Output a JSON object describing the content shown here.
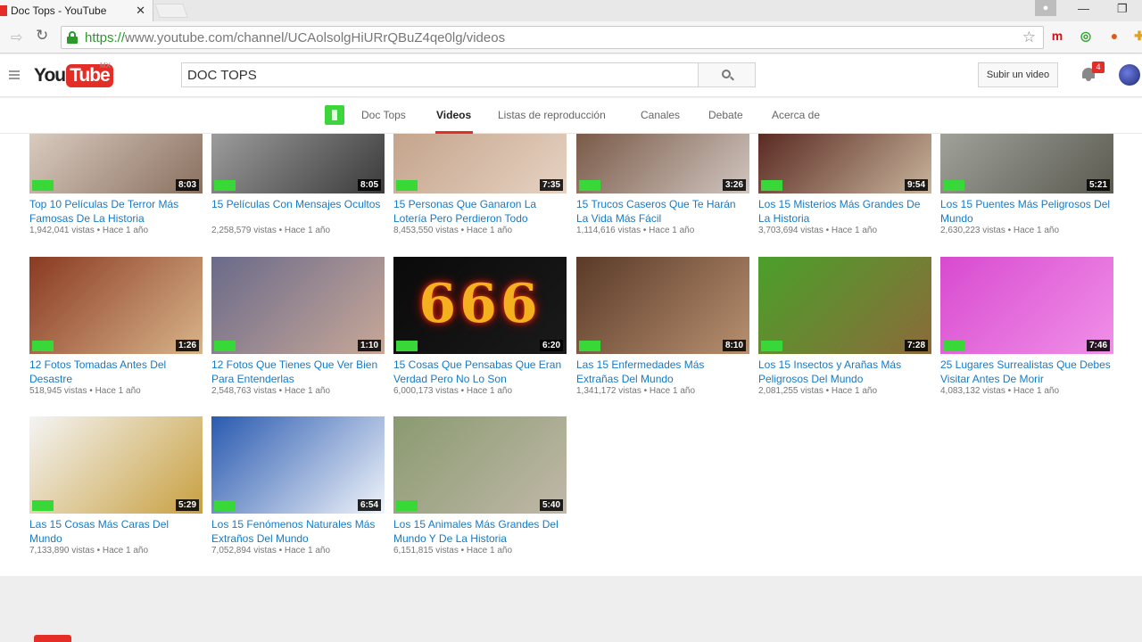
{
  "browser": {
    "tab_title": "Doc Tops - YouTube",
    "tab_close": "✕",
    "url_scheme": "https://",
    "url_rest": "www.youtube.com/channel/UCAolsolgHiURrQBuZ4qe0lg/videos",
    "back_icon": "⇨",
    "reload_icon": "↻",
    "star_icon": "☆",
    "minimize": "—",
    "restore": "❐",
    "extensions": [
      {
        "label": "m",
        "color": "#d0101c"
      },
      {
        "label": "◎",
        "color": "#2ea32e"
      },
      {
        "label": "●",
        "color": "#e05a18"
      }
    ]
  },
  "masthead": {
    "logo_you": "You",
    "logo_tube": "Tube",
    "logo_region": "MX",
    "search_value": "DOC TOPS",
    "upload_label": "Subir un video",
    "notification_count": "4"
  },
  "channel_tabs": {
    "items": [
      "Doc Tops",
      "Videos",
      "Listas de reproducción",
      "Canales",
      "Debate",
      "Acerca de"
    ],
    "active": "Videos"
  },
  "videos": [
    {
      "title": "Top 10 Películas De Terror Más Famosas De La Historia",
      "views": "1,942,041 vistas",
      "age": "Hace 1 año",
      "duration": "8:03",
      "thumb_colors": [
        "#d9cbbf",
        "#8a7060"
      ]
    },
    {
      "title": "15 Películas Con Mensajes Ocultos",
      "views": "2,258,579 vistas",
      "age": "Hace 1 año",
      "duration": "8:05",
      "thumb_colors": [
        "#9c9c9c",
        "#3a3a3a"
      ]
    },
    {
      "title": "15 Personas Que Ganaron La Lotería Pero Perdieron Todo",
      "views": "8,453,550 vistas",
      "age": "Hace 1 año",
      "duration": "7:35",
      "thumb_colors": [
        "#c4a48c",
        "#e6d2c2"
      ]
    },
    {
      "title": "15 Trucos Caseros Que Te Harán La Vida Más Fácil",
      "views": "1,114,616 vistas",
      "age": "Hace 1 año",
      "duration": "3:26",
      "thumb_colors": [
        "#7a5a48",
        "#d0c6c0"
      ]
    },
    {
      "title": "Los 15 Misterios Más Grandes De La Historia",
      "views": "3,703,694 vistas",
      "age": "Hace 1 año",
      "duration": "9:54",
      "thumb_colors": [
        "#5a2a22",
        "#c8b49c"
      ]
    },
    {
      "title": "Los 15 Puentes Más Peligrosos Del Mundo",
      "views": "2,630,223 vistas",
      "age": "Hace 1 año",
      "duration": "5:21",
      "thumb_colors": [
        "#a0a29a",
        "#5a5a50"
      ]
    },
    {
      "title": "12 Fotos Tomadas Antes Del Desastre",
      "views": "518,945 vistas",
      "age": "Hace 1 año",
      "duration": "1:26",
      "thumb_colors": [
        "#8a3a22",
        "#d8b48a"
      ]
    },
    {
      "title": "12 Fotos Que Tienes Que Ver Bien Para Entenderlas",
      "views": "2,548,763 vistas",
      "age": "Hace 1 año",
      "duration": "1:10",
      "thumb_colors": [
        "#6a6a8a",
        "#c8a898"
      ]
    },
    {
      "title": "15 Cosas Que Pensabas Que Eran Verdad Pero No Lo Son",
      "views": "6,000,173 vistas",
      "age": "Hace 1 año",
      "duration": "6:20",
      "thumb_colors": [
        "#0a0a0a",
        "#1a1a1a"
      ],
      "thumb_text": "666"
    },
    {
      "title": "Las 15 Enfermedades Más Extrañas Del Mundo",
      "views": "1,341,172 vistas",
      "age": "Hace 1 año",
      "duration": "8:10",
      "thumb_colors": [
        "#5a3a28",
        "#b89070"
      ]
    },
    {
      "title": "Los 15 Insectos y Arañas Más Peligrosos Del Mundo",
      "views": "2,081,255 vistas",
      "age": "Hace 1 año",
      "duration": "7:28",
      "thumb_colors": [
        "#4aa02a",
        "#8c6a3a"
      ]
    },
    {
      "title": "25 Lugares Surrealistas Que Debes Visitar Antes De Morir",
      "views": "4,083,132 vistas",
      "age": "Hace 1 año",
      "duration": "7:46",
      "thumb_colors": [
        "#d84ad0",
        "#f090e8"
      ]
    },
    {
      "title": "Las 15 Cosas Más Caras Del Mundo",
      "views": "7,133,890 vistas",
      "age": "Hace 1 año",
      "duration": "5:29",
      "thumb_colors": [
        "#f4f4f4",
        "#c8a040"
      ]
    },
    {
      "title": "Los 15 Fenómenos Naturales Más Extraños Del Mundo",
      "views": "7,052,894 vistas",
      "age": "Hace 1 año",
      "duration": "6:54",
      "thumb_colors": [
        "#2a5ab0",
        "#f0f4fa"
      ]
    },
    {
      "title": "Los 15 Animales Más Grandes Del Mundo Y De La Historia",
      "views": "6,151,815 vistas",
      "age": "Hace 1 año",
      "duration": "5:40",
      "thumb_colors": [
        "#8a9a70",
        "#c0b8a8"
      ]
    }
  ]
}
